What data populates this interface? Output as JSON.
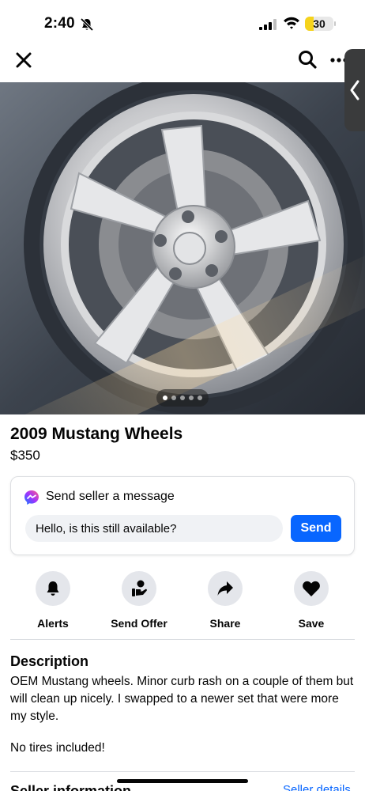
{
  "status_bar": {
    "time": "2:40",
    "battery_level": "30",
    "icons": [
      "bell-slash-icon",
      "cellular-signal-icon",
      "wifi-icon",
      "battery-icon"
    ]
  },
  "nav": {
    "icons": [
      "close-icon",
      "search-icon",
      "more-icon",
      "chevron-left-icon"
    ]
  },
  "listing": {
    "photo_count": 5,
    "active_photo": 1,
    "title": "2009 Mustang Wheels",
    "price": "$350"
  },
  "message": {
    "label": "Send seller a message",
    "input_value": "Hello, is this still available?",
    "send_label": "Send"
  },
  "actions": [
    {
      "label": "Alerts",
      "icon": "bell-icon"
    },
    {
      "label": "Send Offer",
      "icon": "offer-hand-icon"
    },
    {
      "label": "Share",
      "icon": "share-arrow-icon"
    },
    {
      "label": "Save",
      "icon": "heart-icon"
    }
  ],
  "description": {
    "heading": "Description",
    "text": "OEM Mustang wheels. Minor curb rash on a couple of them but will clean up nicely. I swapped to a newer set that were more my style.",
    "text2": "No tires included!"
  },
  "seller": {
    "heading": "Seller information",
    "link": "Seller details"
  },
  "colors": {
    "accent": "#0866ff",
    "action_bg": "#e4e6eb",
    "input_bg": "#f0f2f5",
    "battery": "#f5d31c"
  }
}
